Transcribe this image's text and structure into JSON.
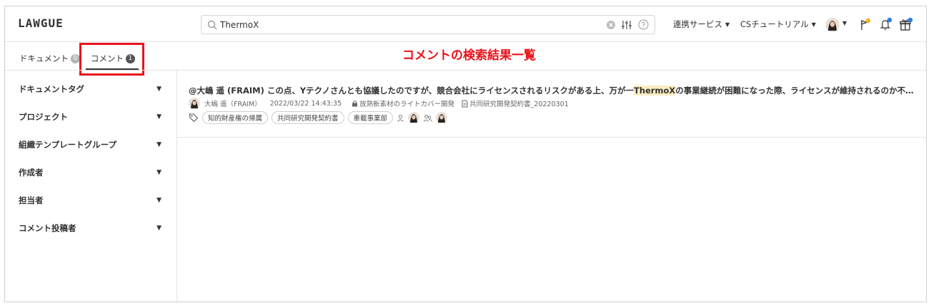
{
  "header": {
    "logo": "LAWGUE",
    "search": {
      "value": "ThermoX",
      "placeholder": ""
    },
    "menu_integrations": "連携サービス",
    "menu_tutorial": "CSチュートリアル"
  },
  "tabs": {
    "documents_label": "ドキュメント",
    "documents_count": "0",
    "comments_label": "コメント",
    "comments_count": "1"
  },
  "annotation": "コメントの検索結果一覧",
  "sidebar": {
    "filters": [
      "ドキュメントタグ",
      "プロジェクト",
      "組織テンプレートグループ",
      "作成者",
      "担当者",
      "コメント投稿者"
    ]
  },
  "result": {
    "title_before": "@大嶋 遥 (FRAIM) この点、Yテクノさんとも協議したのですが、競合会社にライセンスされるリスクがある上、万が一",
    "title_highlight": "ThermoX",
    "title_after": "の事業継続が困難になった際、ライセンスが維持されるのか不透明に...",
    "author": "大嶋 遥（FRAIM）",
    "datetime": "2022/03/22 14:43:35",
    "project": "放熱新素材のライトカバー開発",
    "document": "共同研究開発契約書_20220301",
    "tags": [
      "知的財産権の帰属",
      "共同研究開発契約書",
      "車載事業部"
    ]
  },
  "colors": {
    "accent_red": "#e8131a",
    "highlight": "#fcecc2",
    "badge_yellow": "#f5b323",
    "badge_blue": "#2f7fe0"
  }
}
